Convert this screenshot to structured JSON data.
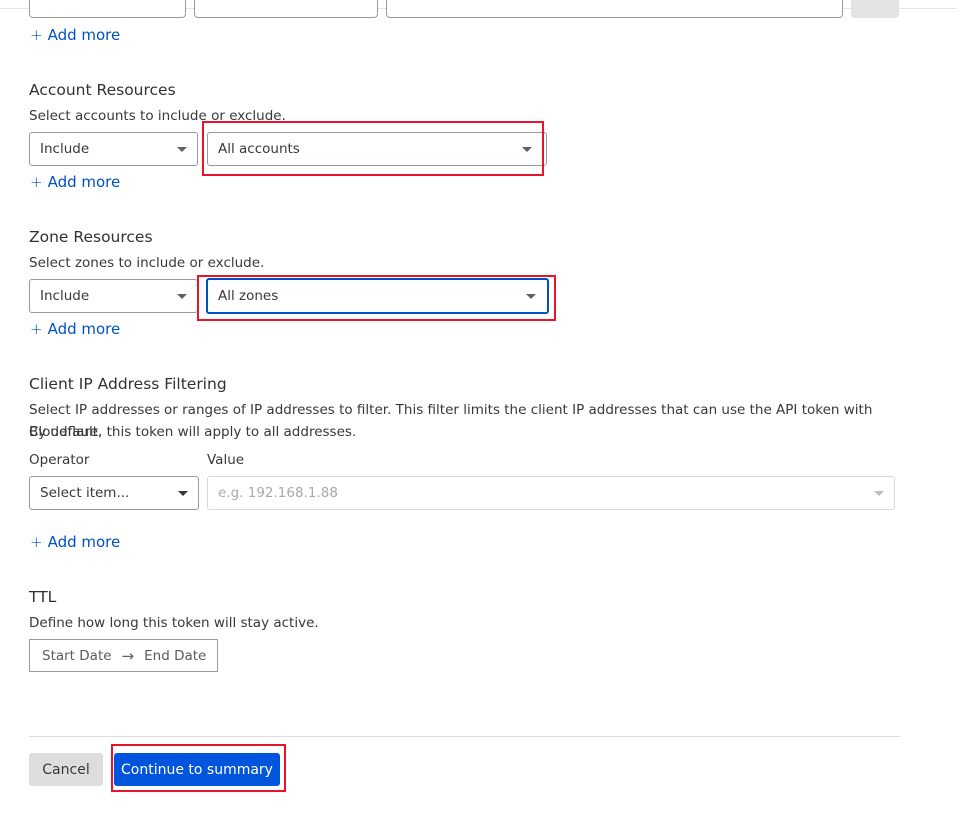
{
  "top_fragment": {
    "add_more_label": "Add more"
  },
  "account_resources": {
    "title": "Account Resources",
    "description": "Select accounts to include or exclude.",
    "include_value": "Include",
    "account_value": "All accounts",
    "add_more_label": "Add more"
  },
  "zone_resources": {
    "title": "Zone Resources",
    "description": "Select zones to include or exclude.",
    "include_value": "Include",
    "zone_value": "All zones",
    "add_more_label": "Add more"
  },
  "ip_filtering": {
    "title": "Client IP Address Filtering",
    "description_line1": "Select IP addresses or ranges of IP addresses to filter. This filter limits the client IP addresses that can use the API token with Cloudflare.",
    "description_line2": "By default, this token will apply to all addresses.",
    "operator_label": "Operator",
    "value_label": "Value",
    "operator_placeholder": "Select item...",
    "value_placeholder": "e.g. 192.168.1.88",
    "add_more_label": "Add more"
  },
  "ttl": {
    "title": "TTL",
    "description": "Define how long this token will stay active.",
    "start_date_label": "Start Date",
    "arrow": "→",
    "end_date_label": "End Date"
  },
  "footer": {
    "cancel_label": "Cancel",
    "continue_label": "Continue to summary"
  },
  "colors": {
    "link": "#0051c3",
    "primary_button": "#0055dc",
    "highlight_box": "#e8132c"
  },
  "icons": [
    "plus-icon",
    "caret-down-icon",
    "arrow-right-icon"
  ]
}
